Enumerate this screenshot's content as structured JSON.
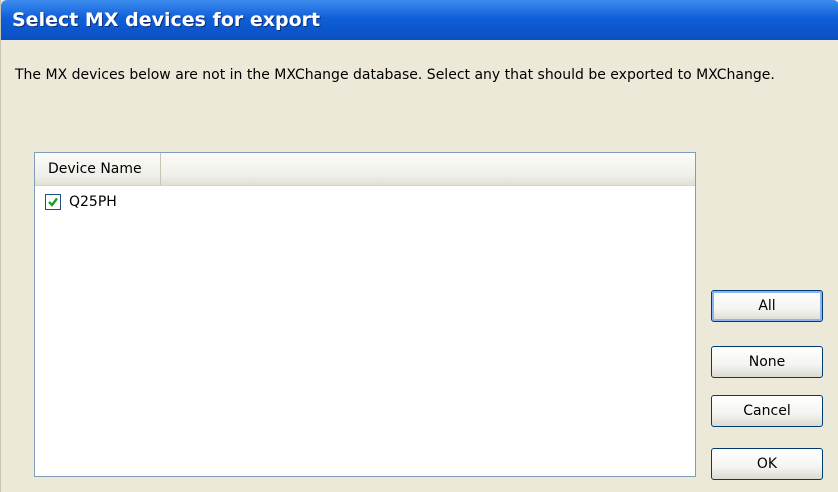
{
  "window": {
    "title": "Select MX devices for export"
  },
  "description": "The MX devices below are not in the MXChange database. Select any that should be exported to MXChange.",
  "list": {
    "columns": [
      "Device Name"
    ],
    "rows": [
      {
        "label": "Q25PH",
        "checked": true
      }
    ]
  },
  "buttons": {
    "all": "All",
    "none": "None",
    "cancel": "Cancel",
    "ok": "OK"
  }
}
